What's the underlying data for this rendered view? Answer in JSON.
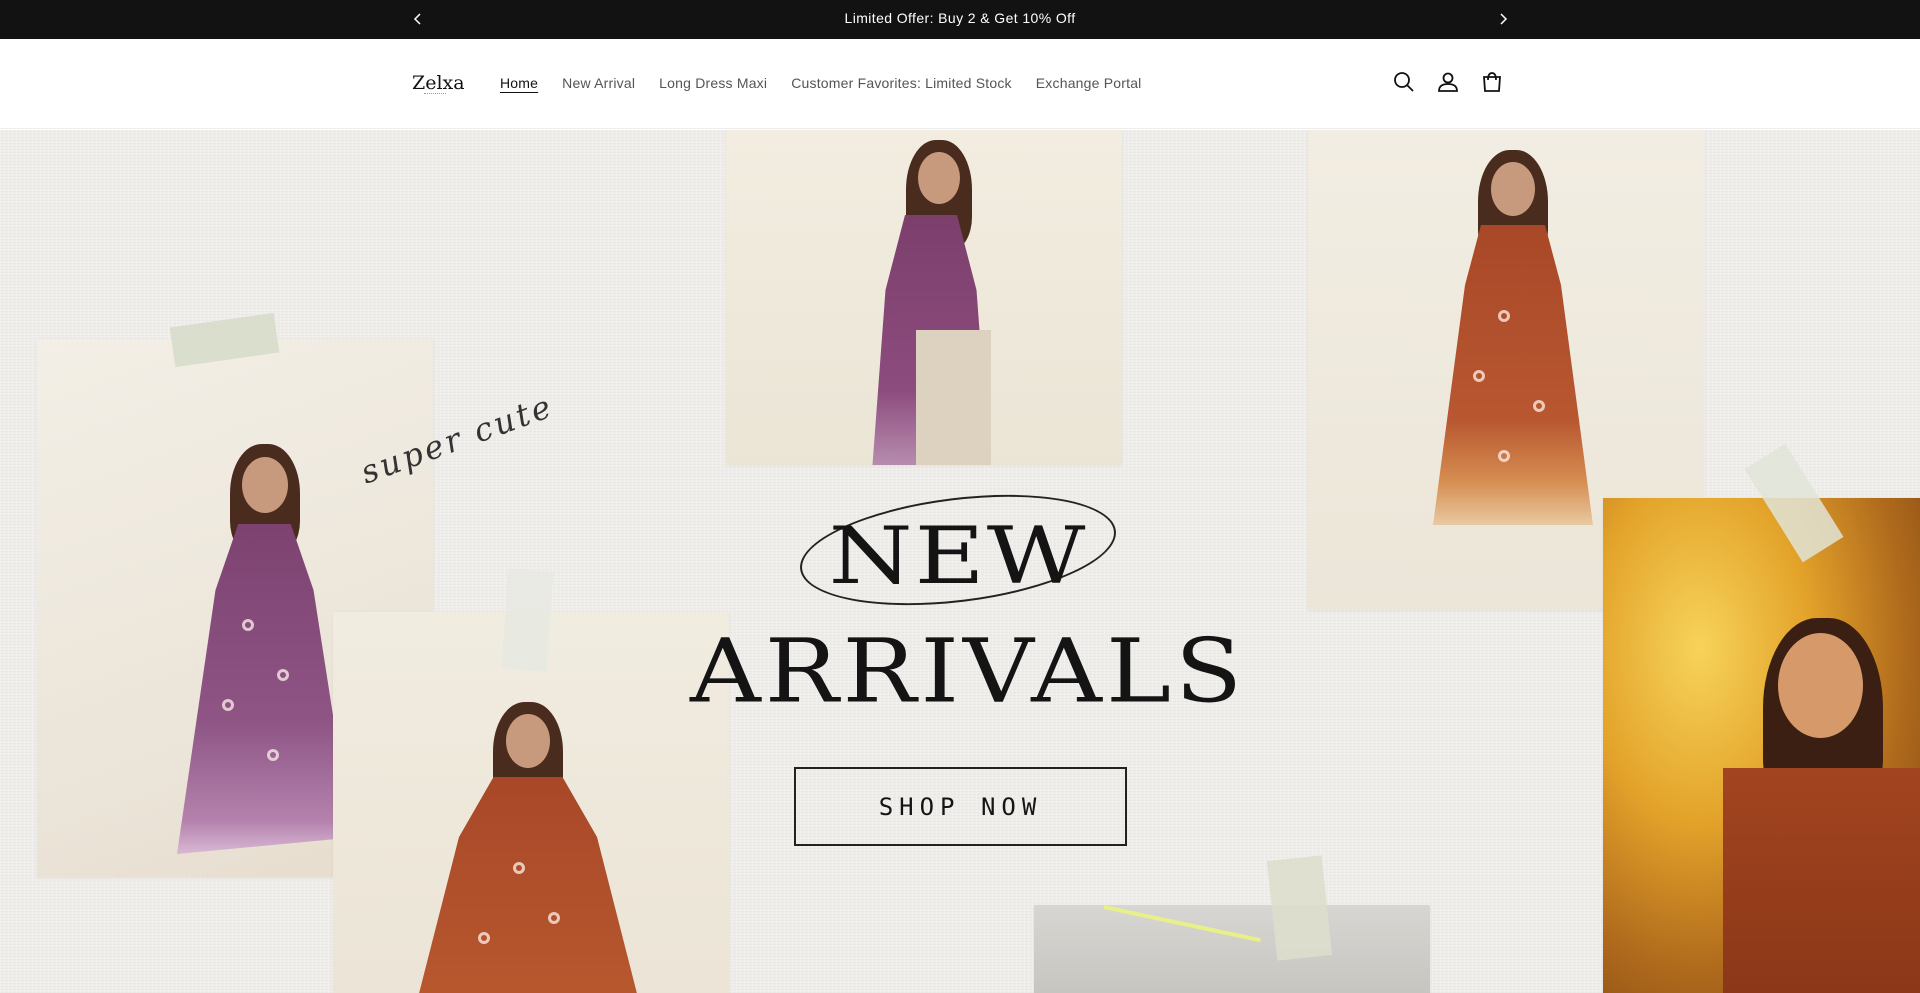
{
  "announcement": {
    "text": "Limited Offer: Buy 2 & Get 10% Off",
    "prev_icon": "chevron-left-icon",
    "next_icon": "chevron-right-icon"
  },
  "header": {
    "logo": "Zelxa",
    "nav": [
      {
        "label": "Home",
        "active": true
      },
      {
        "label": "New Arrival",
        "active": false
      },
      {
        "label": "Long Dress Maxi",
        "active": false
      },
      {
        "label": "Customer Favorites: Limited Stock",
        "active": false
      },
      {
        "label": "Exchange Portal",
        "active": false
      }
    ],
    "icons": [
      "search-icon",
      "account-icon",
      "cart-icon"
    ]
  },
  "hero": {
    "script_text": "super cute",
    "title_line1": "NEW",
    "title_line2": "ARRIVALS",
    "cta_label": "SHOP NOW",
    "colors": {
      "background": "#efedea",
      "purple_dress": "#8a4d7e",
      "rust_dress": "#b3532e",
      "text": "#141414"
    }
  }
}
